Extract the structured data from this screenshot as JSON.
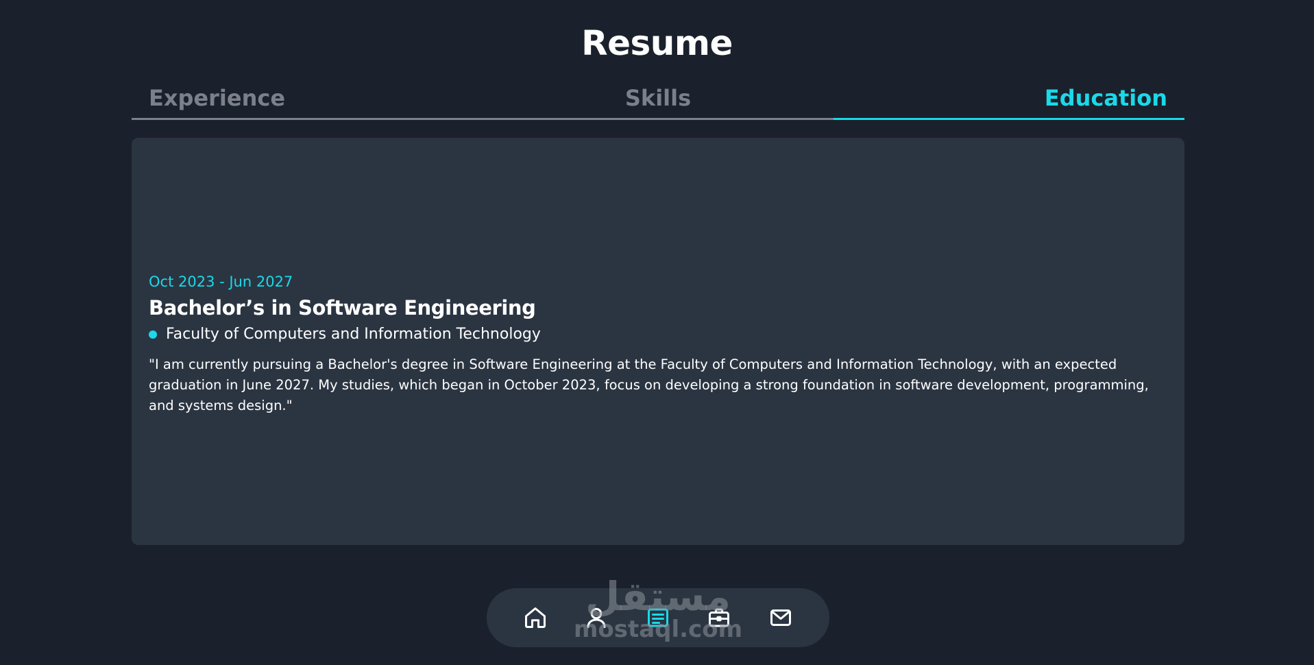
{
  "page": {
    "title": "Resume"
  },
  "tabs": [
    {
      "label": "Experience",
      "active": false
    },
    {
      "label": "Skills",
      "active": false
    },
    {
      "label": "Education",
      "active": true
    }
  ],
  "education": {
    "date_range": "Oct 2023 - Jun 2027",
    "degree": "Bachelor’s in Software Engineering",
    "institution": "Faculty of Computers and Information Technology",
    "description": "\"I am currently pursuing a Bachelor's degree in Software Engineering at the Faculty of Computers and Information Technology, with an expected graduation in June 2027. My studies, which began in October 2023, focus on developing a strong foundation in software development, programming, and systems design.\""
  },
  "nav": {
    "items": [
      {
        "icon": "home-icon",
        "active": false
      },
      {
        "icon": "user-icon",
        "active": false
      },
      {
        "icon": "resume-icon",
        "active": true
      },
      {
        "icon": "briefcase-icon",
        "active": false
      },
      {
        "icon": "mail-icon",
        "active": false
      }
    ]
  },
  "watermark": {
    "logo_text": "مستقل",
    "site": "mostaql.com"
  },
  "colors": {
    "background": "#1b212c",
    "card": "#2b3542",
    "accent": "#1ad9e9",
    "muted": "#7b808b",
    "text": "#ffffff"
  }
}
